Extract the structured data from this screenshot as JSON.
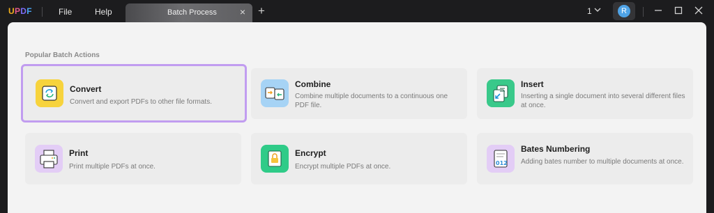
{
  "app": {
    "logo_text": "UPDF",
    "menu": {
      "file": "File",
      "help": "Help"
    },
    "tab": {
      "label": "Batch Process",
      "close_glyph": "×"
    },
    "new_tab_glyph": "+",
    "page_number": "1",
    "avatar_initial": "R"
  },
  "main": {
    "section_title": "Popular Batch Actions",
    "cards": [
      {
        "title": "Convert",
        "desc": "Convert and export PDFs to other file formats.",
        "icon": "convert-icon",
        "color": "#f7d33d",
        "selected": true
      },
      {
        "title": "Combine",
        "desc": "Combine multiple documents to a continuous one PDF file.",
        "icon": "combine-icon",
        "color": "#a6d3f5"
      },
      {
        "title": "Insert",
        "desc": "Inserting a single document into several different files at once.",
        "icon": "insert-icon",
        "color": "#39c98a"
      },
      {
        "title": "Print",
        "desc": "Print multiple PDFs at once.",
        "icon": "print-icon",
        "color": "#e3cdf6"
      },
      {
        "title": "Encrypt",
        "desc": "Encrypt multiple PDFs at once.",
        "icon": "encrypt-icon",
        "color": "#2fcb88"
      },
      {
        "title": "Bates Numbering",
        "desc": "Adding bates number to multiple documents at once.",
        "icon": "bates-numbering-icon",
        "color": "#e3cdf6"
      }
    ]
  },
  "colors": {
    "titlebar_bg": "#1c1c1e",
    "content_bg": "#f3f3f3",
    "selection_border": "#c19cf0"
  }
}
